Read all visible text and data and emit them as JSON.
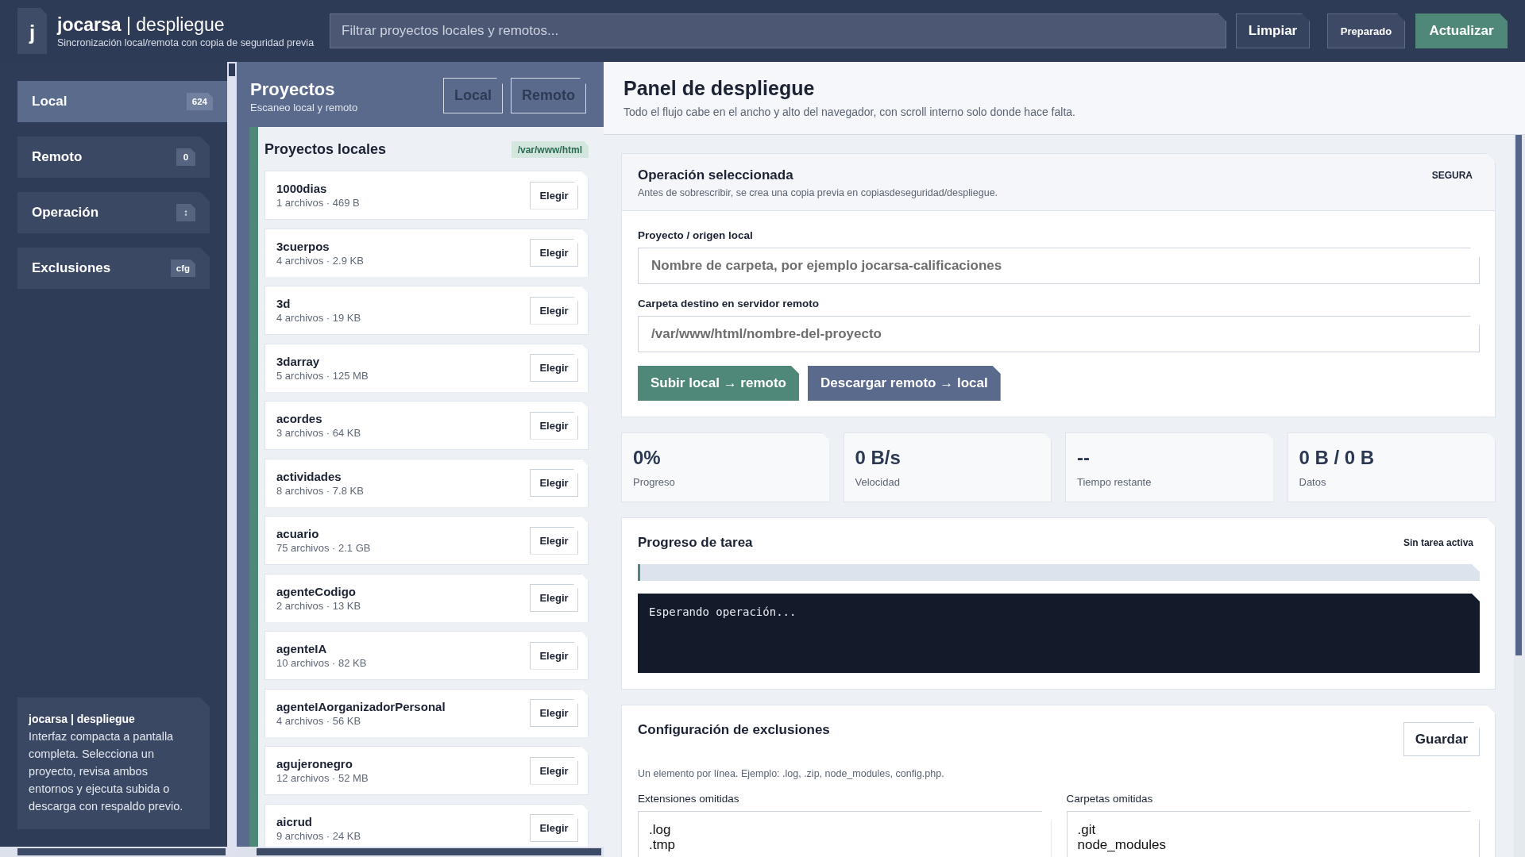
{
  "header": {
    "logo": "j",
    "title": "**jocarsa** | despliegue",
    "subtitle": "Sincronización local/remota con copia de seguridad previa",
    "search": {
      "placeholder": "Filtrar proyectos locales y remotos..."
    },
    "clear_button": "Limpiar",
    "status": "Preparado",
    "refresh_button": "Actualizar"
  },
  "sidebar": {
    "items": [
      {
        "label": "Local",
        "badge": "624",
        "selected": true
      },
      {
        "label": "Remoto",
        "badge": "0",
        "selected": false
      },
      {
        "label": "Operación",
        "badge": "↕",
        "selected": false
      },
      {
        "label": "Exclusiones",
        "badge": "cfg",
        "selected": false
      }
    ],
    "about": {
      "title": "jocarsa | despliegue",
      "text": "Interfaz compacta a pantalla completa. Selecciona un proyecto, revisa ambos entornos y ejecuta subida o descarga con respaldo previo."
    }
  },
  "projects": {
    "title": "Proyectos",
    "subtitle": "Escaneo local y remoto",
    "tabs": [
      {
        "label": "Local",
        "selected": false
      },
      {
        "label": "Remoto",
        "selected": false
      }
    ],
    "list_title": "Proyectos locales",
    "path": "/var/www/html",
    "items": [
      {
        "name": "1000dias",
        "meta": "1 archivos · 469 B",
        "action": "Elegir"
      },
      {
        "name": "3cuerpos",
        "meta": "4 archivos · 2.9 KB",
        "action": "Elegir"
      },
      {
        "name": "3d",
        "meta": "4 archivos · 19 KB",
        "action": "Elegir"
      },
      {
        "name": "3darray",
        "meta": "5 archivos · 125 MB",
        "action": "Elegir"
      },
      {
        "name": "acordes",
        "meta": "3 archivos · 64 KB",
        "action": "Elegir"
      },
      {
        "name": "actividades",
        "meta": "8 archivos · 7.8 KB",
        "action": "Elegir"
      },
      {
        "name": "acuario",
        "meta": "75 archivos · 2.1 GB",
        "action": "Elegir"
      },
      {
        "name": "agenteCodigo",
        "meta": "2 archivos · 13 KB",
        "action": "Elegir"
      },
      {
        "name": "agenteIA",
        "meta": "10 archivos · 82 KB",
        "action": "Elegir"
      },
      {
        "name": "agenteIAorganizadorPersonal",
        "meta": "4 archivos · 56 KB",
        "action": "Elegir"
      },
      {
        "name": "agujeronegro",
        "meta": "12 archivos · 52 MB",
        "action": "Elegir"
      },
      {
        "name": "aicrud",
        "meta": "9 archivos · 24 KB",
        "action": "Elegir"
      }
    ]
  },
  "panel": {
    "title": "Panel de despliegue",
    "subtitle": "Todo el flujo cabe en el ancho y alto del navegador, con scroll interno solo donde hace falta.",
    "operation": {
      "title": "Operación seleccionada",
      "subtitle": "Antes de sobrescribir, se crea una copia previa en copiasdeseguridad/despliegue.",
      "badge": "SEGURA",
      "fields": [
        {
          "label": "Proyecto / origen local",
          "placeholder": "Nombre de carpeta, por ejemplo jocarsa-calificaciones"
        },
        {
          "label": "Carpeta destino en servidor remoto",
          "placeholder": "/var/www/html/nombre-del-proyecto"
        }
      ],
      "buttons": [
        {
          "label": "Subir local → remoto",
          "kind": "primary"
        },
        {
          "label": "Descargar remoto → local",
          "kind": "secondary"
        }
      ]
    },
    "stats": [
      {
        "value": "0%",
        "label": "Progreso"
      },
      {
        "value": "0 B/s",
        "label": "Velocidad"
      },
      {
        "value": "--",
        "label": "Tiempo restante"
      },
      {
        "value": "0 B / 0 B",
        "label": "Datos"
      }
    ],
    "task": {
      "title": "Progreso de tarea",
      "status": "Sin tarea activa",
      "level": 0,
      "log": "Esperando operación..."
    },
    "exclusions": {
      "title": "Configuración de exclusiones",
      "save_button": "Guardar",
      "help": "Un elemento por línea. Ejemplo: .log, .zip, node_modules, config.php.",
      "fields": [
        {
          "label": "Extensiones omitidas",
          "value": ".log\n.tmp"
        },
        {
          "label": "Carpetas omitidas",
          "value": ".git\nnode_modules"
        }
      ]
    }
  }
}
